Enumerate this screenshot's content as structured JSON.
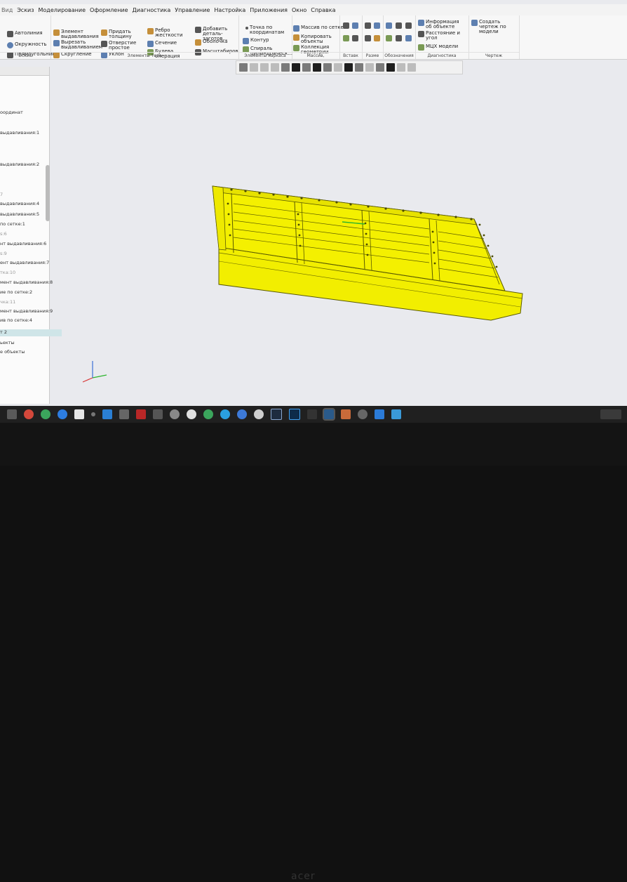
{
  "menu": [
    "Вид",
    "Эскиз",
    "Моделирование",
    "Оформление",
    "Диагностика",
    "Управление",
    "Настройка",
    "Приложения",
    "Окно",
    "Справка"
  ],
  "ribbon": {
    "sketch": {
      "items": [
        "Автолиния",
        "Окружность",
        "Прямоугольник"
      ],
      "caption": "Эскиз"
    },
    "body": {
      "items": [
        "Элемент выдавливания",
        "Вырезать выдавливанием",
        "Скругление",
        "Придать толщину",
        "Отверстие простое",
        "Уклон",
        "Ребро жесткости",
        "Сечение",
        "Булева операция",
        "Добавить деталь-заготов...",
        "Оболочка",
        "Масштабиров..."
      ],
      "caption": "Элементы тела"
    },
    "frame": {
      "items": [
        "Точка по координатам",
        "Контур",
        "Спираль цилиндрическ..."
      ],
      "caption": "Элементы каркаса"
    },
    "array": {
      "items": [
        "Массив по сетке",
        "Копировать объекты",
        "Коллекция геометрии"
      ],
      "caption": "Массив, копирование"
    },
    "insert": {
      "caption": "Вставк"
    },
    "size": {
      "caption": "Разме"
    },
    "notation": {
      "caption": "Обозначения"
    },
    "diag": {
      "items": [
        "Информация об объекте",
        "Расстояние и угол",
        "МЦХ модели"
      ],
      "caption": "Диагностика"
    },
    "drawing": {
      "items": [
        "Создать чертеж по модели"
      ],
      "caption": "Чертеж"
    }
  },
  "tree": {
    "items": [
      {
        "label": "оординат",
        "muted": false
      },
      {
        "label": "выдавливания:1",
        "muted": false
      },
      {
        "label": "выдавливания:2",
        "muted": false
      },
      {
        "label": "7",
        "muted": true
      },
      {
        "label": "выдавливания:4",
        "muted": false
      },
      {
        "label": "выдавливания:5",
        "muted": false
      },
      {
        "label": "по сетке:1",
        "muted": false
      },
      {
        "label": "s:6",
        "muted": true
      },
      {
        "label": "нт выдавливания:6",
        "muted": false
      },
      {
        "label": "s:9",
        "muted": true
      },
      {
        "label": "ент выдавливания:7",
        "muted": false
      },
      {
        "label": "тка:10",
        "muted": true
      },
      {
        "label": "мент выдавливания:8",
        "muted": false
      },
      {
        "label": "ие по сетке:2",
        "muted": false
      },
      {
        "label": "чка:11",
        "muted": true
      },
      {
        "label": "мент выдавливания:9",
        "muted": false
      },
      {
        "label": "ив по сетке:4",
        "muted": false
      },
      {
        "label": "т 2",
        "muted": false
      },
      {
        "label": "ьекты",
        "muted": false
      },
      {
        "label": "е объекты",
        "muted": false
      }
    ]
  },
  "colors": {
    "model": "#f4f000",
    "model_edge": "#5a5a00",
    "viewport": "#e9eaee"
  }
}
